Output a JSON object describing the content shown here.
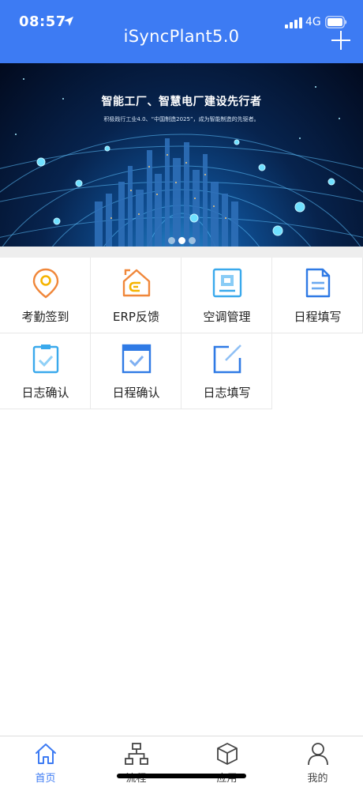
{
  "status": {
    "time": "08:57",
    "network": "4G"
  },
  "header": {
    "title": "iSyncPlant5.0"
  },
  "banner": {
    "title": "智能工厂、智慧电厂建设先行者",
    "subtitle": "积极践行工业4.0、“中国制造2025”，成为智能制造的先驱者。",
    "slide_count": 3,
    "active_slide": 1
  },
  "apps": [
    {
      "label": "考勤签到",
      "icon": "location-pin-icon"
    },
    {
      "label": "ERP反馈",
      "icon": "erp-feedback-icon"
    },
    {
      "label": "空调管理",
      "icon": "air-conditioner-icon"
    },
    {
      "label": "日程填写",
      "icon": "schedule-document-icon"
    },
    {
      "label": "日志确认",
      "icon": "clipboard-check-icon"
    },
    {
      "label": "日程确认",
      "icon": "calendar-check-icon"
    },
    {
      "label": "日志填写",
      "icon": "edit-note-icon"
    }
  ],
  "tabs": [
    {
      "label": "首页",
      "icon": "home-icon",
      "active": true
    },
    {
      "label": "流程",
      "icon": "flowchart-icon",
      "active": false
    },
    {
      "label": "应用",
      "icon": "cube-icon",
      "active": false
    },
    {
      "label": "我的",
      "icon": "person-icon",
      "active": false
    }
  ],
  "colors": {
    "primary": "#3d7bf3",
    "orange": "#f0873a",
    "sky": "#3aa9ec",
    "blue": "#2f7ae5"
  }
}
